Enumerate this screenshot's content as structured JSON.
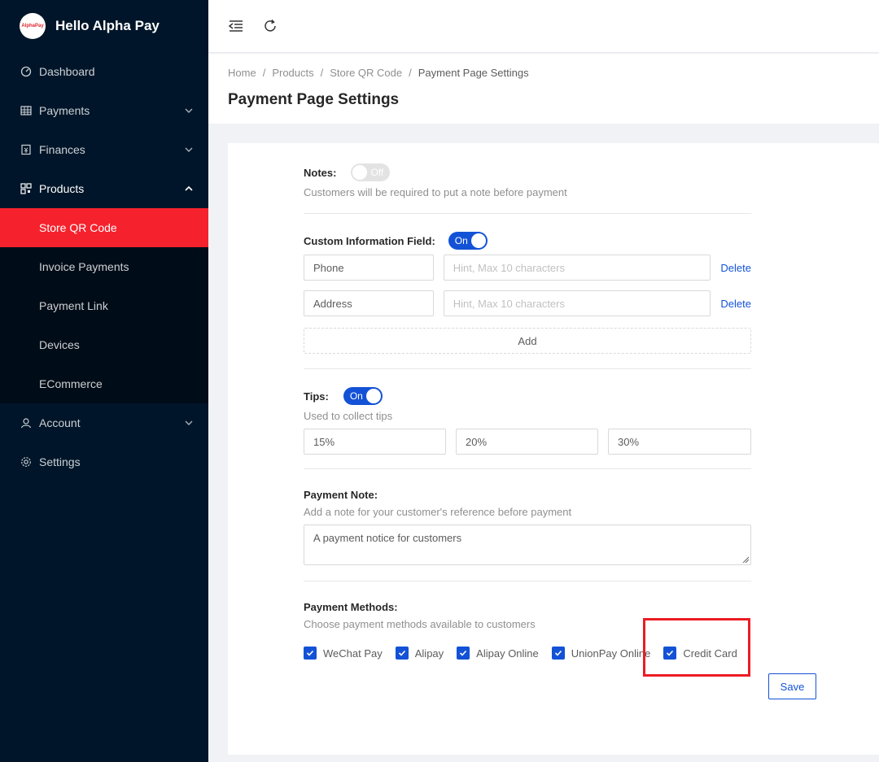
{
  "app": {
    "title": "Hello Alpha Pay",
    "logo_text": "AlphaPay"
  },
  "sidebar": {
    "items": [
      {
        "label": "Dashboard",
        "icon": "dashboard-icon"
      },
      {
        "label": "Payments",
        "icon": "table-icon"
      },
      {
        "label": "Finances",
        "icon": "account-book-icon"
      },
      {
        "label": "Products",
        "icon": "qrcode-icon"
      },
      {
        "label": "Account",
        "icon": "user-icon"
      },
      {
        "label": "Settings",
        "icon": "gear-icon"
      }
    ],
    "products_sub": [
      {
        "label": "Store QR Code"
      },
      {
        "label": "Invoice Payments"
      },
      {
        "label": "Payment Link"
      },
      {
        "label": "Devices"
      },
      {
        "label": "ECommerce"
      }
    ]
  },
  "breadcrumb": [
    "Home",
    "Products",
    "Store QR Code",
    "Payment Page Settings"
  ],
  "page_title": "Payment Page Settings",
  "notes": {
    "label": "Notes:",
    "switch": "Off",
    "hint": "Customers will be required to put a note before payment"
  },
  "custom_info": {
    "label": "Custom Information Field:",
    "switch": "On",
    "fields": [
      {
        "name": "Phone",
        "hint_placeholder": "Hint, Max 10 characters",
        "delete": "Delete"
      },
      {
        "name": "Address",
        "hint_placeholder": "Hint, Max 10 characters",
        "delete": "Delete"
      }
    ],
    "add": "Add"
  },
  "tips": {
    "label": "Tips:",
    "switch": "On",
    "hint": "Used to collect tips",
    "values": [
      "15%",
      "20%",
      "30%"
    ]
  },
  "payment_note": {
    "label": "Payment Note:",
    "hint": "Add a note for your customer's reference before payment",
    "value": "A payment notice for customers"
  },
  "payment_methods": {
    "label": "Payment Methods:",
    "hint": "Choose payment methods available to customers",
    "options": [
      "WeChat Pay",
      "Alipay",
      "Alipay Online",
      "UnionPay Online",
      "Credit Card"
    ]
  },
  "save": "Save",
  "colors": {
    "sidebar": "#001529",
    "active": "#f5222d",
    "primary": "#1352d6",
    "highlight": "#ec1c24"
  }
}
